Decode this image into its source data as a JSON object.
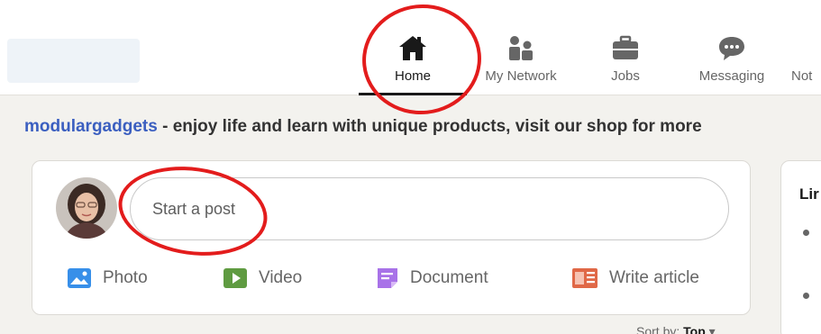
{
  "nav": {
    "items": [
      {
        "label": "Home",
        "icon": "home-icon"
      },
      {
        "label": "My Network",
        "icon": "network-icon"
      },
      {
        "label": "Jobs",
        "icon": "briefcase-icon"
      },
      {
        "label": "Messaging",
        "icon": "message-icon"
      },
      {
        "label": "Not",
        "icon": ""
      }
    ]
  },
  "promo": {
    "brand": "modulargadgets",
    "text": " - enjoy life and learn with unique products, visit our shop for more"
  },
  "composer": {
    "placeholder": "Start a post",
    "actions": [
      {
        "label": "Photo",
        "icon": "photo-icon",
        "color": "#378fe9"
      },
      {
        "label": "Video",
        "icon": "video-icon",
        "color": "#5f9b41"
      },
      {
        "label": "Document",
        "icon": "document-icon",
        "color": "#a872e8"
      },
      {
        "label": "Write article",
        "icon": "article-icon",
        "color": "#e06847"
      }
    ]
  },
  "right_card": {
    "title": "Lir"
  },
  "sort": {
    "label": "Sort by:",
    "value": "Top"
  },
  "colors": {
    "background": "#f3f2ee",
    "brand": "#3b5fc0",
    "annotation": "#e31c1c"
  }
}
